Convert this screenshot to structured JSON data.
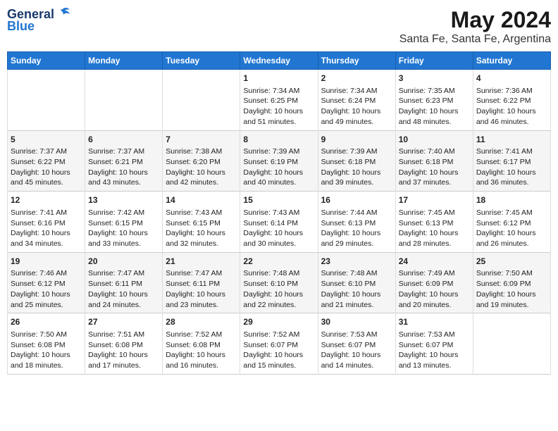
{
  "logo": {
    "general": "General",
    "blue": "Blue"
  },
  "title": "May 2024",
  "subtitle": "Santa Fe, Santa Fe, Argentina",
  "weekdays": [
    "Sunday",
    "Monday",
    "Tuesday",
    "Wednesday",
    "Thursday",
    "Friday",
    "Saturday"
  ],
  "weeks": [
    [
      {
        "day": "",
        "info": ""
      },
      {
        "day": "",
        "info": ""
      },
      {
        "day": "",
        "info": ""
      },
      {
        "day": "1",
        "info": "Sunrise: 7:34 AM\nSunset: 6:25 PM\nDaylight: 10 hours\nand 51 minutes."
      },
      {
        "day": "2",
        "info": "Sunrise: 7:34 AM\nSunset: 6:24 PM\nDaylight: 10 hours\nand 49 minutes."
      },
      {
        "day": "3",
        "info": "Sunrise: 7:35 AM\nSunset: 6:23 PM\nDaylight: 10 hours\nand 48 minutes."
      },
      {
        "day": "4",
        "info": "Sunrise: 7:36 AM\nSunset: 6:22 PM\nDaylight: 10 hours\nand 46 minutes."
      }
    ],
    [
      {
        "day": "5",
        "info": "Sunrise: 7:37 AM\nSunset: 6:22 PM\nDaylight: 10 hours\nand 45 minutes."
      },
      {
        "day": "6",
        "info": "Sunrise: 7:37 AM\nSunset: 6:21 PM\nDaylight: 10 hours\nand 43 minutes."
      },
      {
        "day": "7",
        "info": "Sunrise: 7:38 AM\nSunset: 6:20 PM\nDaylight: 10 hours\nand 42 minutes."
      },
      {
        "day": "8",
        "info": "Sunrise: 7:39 AM\nSunset: 6:19 PM\nDaylight: 10 hours\nand 40 minutes."
      },
      {
        "day": "9",
        "info": "Sunrise: 7:39 AM\nSunset: 6:18 PM\nDaylight: 10 hours\nand 39 minutes."
      },
      {
        "day": "10",
        "info": "Sunrise: 7:40 AM\nSunset: 6:18 PM\nDaylight: 10 hours\nand 37 minutes."
      },
      {
        "day": "11",
        "info": "Sunrise: 7:41 AM\nSunset: 6:17 PM\nDaylight: 10 hours\nand 36 minutes."
      }
    ],
    [
      {
        "day": "12",
        "info": "Sunrise: 7:41 AM\nSunset: 6:16 PM\nDaylight: 10 hours\nand 34 minutes."
      },
      {
        "day": "13",
        "info": "Sunrise: 7:42 AM\nSunset: 6:15 PM\nDaylight: 10 hours\nand 33 minutes."
      },
      {
        "day": "14",
        "info": "Sunrise: 7:43 AM\nSunset: 6:15 PM\nDaylight: 10 hours\nand 32 minutes."
      },
      {
        "day": "15",
        "info": "Sunrise: 7:43 AM\nSunset: 6:14 PM\nDaylight: 10 hours\nand 30 minutes."
      },
      {
        "day": "16",
        "info": "Sunrise: 7:44 AM\nSunset: 6:13 PM\nDaylight: 10 hours\nand 29 minutes."
      },
      {
        "day": "17",
        "info": "Sunrise: 7:45 AM\nSunset: 6:13 PM\nDaylight: 10 hours\nand 28 minutes."
      },
      {
        "day": "18",
        "info": "Sunrise: 7:45 AM\nSunset: 6:12 PM\nDaylight: 10 hours\nand 26 minutes."
      }
    ],
    [
      {
        "day": "19",
        "info": "Sunrise: 7:46 AM\nSunset: 6:12 PM\nDaylight: 10 hours\nand 25 minutes."
      },
      {
        "day": "20",
        "info": "Sunrise: 7:47 AM\nSunset: 6:11 PM\nDaylight: 10 hours\nand 24 minutes."
      },
      {
        "day": "21",
        "info": "Sunrise: 7:47 AM\nSunset: 6:11 PM\nDaylight: 10 hours\nand 23 minutes."
      },
      {
        "day": "22",
        "info": "Sunrise: 7:48 AM\nSunset: 6:10 PM\nDaylight: 10 hours\nand 22 minutes."
      },
      {
        "day": "23",
        "info": "Sunrise: 7:48 AM\nSunset: 6:10 PM\nDaylight: 10 hours\nand 21 minutes."
      },
      {
        "day": "24",
        "info": "Sunrise: 7:49 AM\nSunset: 6:09 PM\nDaylight: 10 hours\nand 20 minutes."
      },
      {
        "day": "25",
        "info": "Sunrise: 7:50 AM\nSunset: 6:09 PM\nDaylight: 10 hours\nand 19 minutes."
      }
    ],
    [
      {
        "day": "26",
        "info": "Sunrise: 7:50 AM\nSunset: 6:08 PM\nDaylight: 10 hours\nand 18 minutes."
      },
      {
        "day": "27",
        "info": "Sunrise: 7:51 AM\nSunset: 6:08 PM\nDaylight: 10 hours\nand 17 minutes."
      },
      {
        "day": "28",
        "info": "Sunrise: 7:52 AM\nSunset: 6:08 PM\nDaylight: 10 hours\nand 16 minutes."
      },
      {
        "day": "29",
        "info": "Sunrise: 7:52 AM\nSunset: 6:07 PM\nDaylight: 10 hours\nand 15 minutes."
      },
      {
        "day": "30",
        "info": "Sunrise: 7:53 AM\nSunset: 6:07 PM\nDaylight: 10 hours\nand 14 minutes."
      },
      {
        "day": "31",
        "info": "Sunrise: 7:53 AM\nSunset: 6:07 PM\nDaylight: 10 hours\nand 13 minutes."
      },
      {
        "day": "",
        "info": ""
      }
    ]
  ]
}
